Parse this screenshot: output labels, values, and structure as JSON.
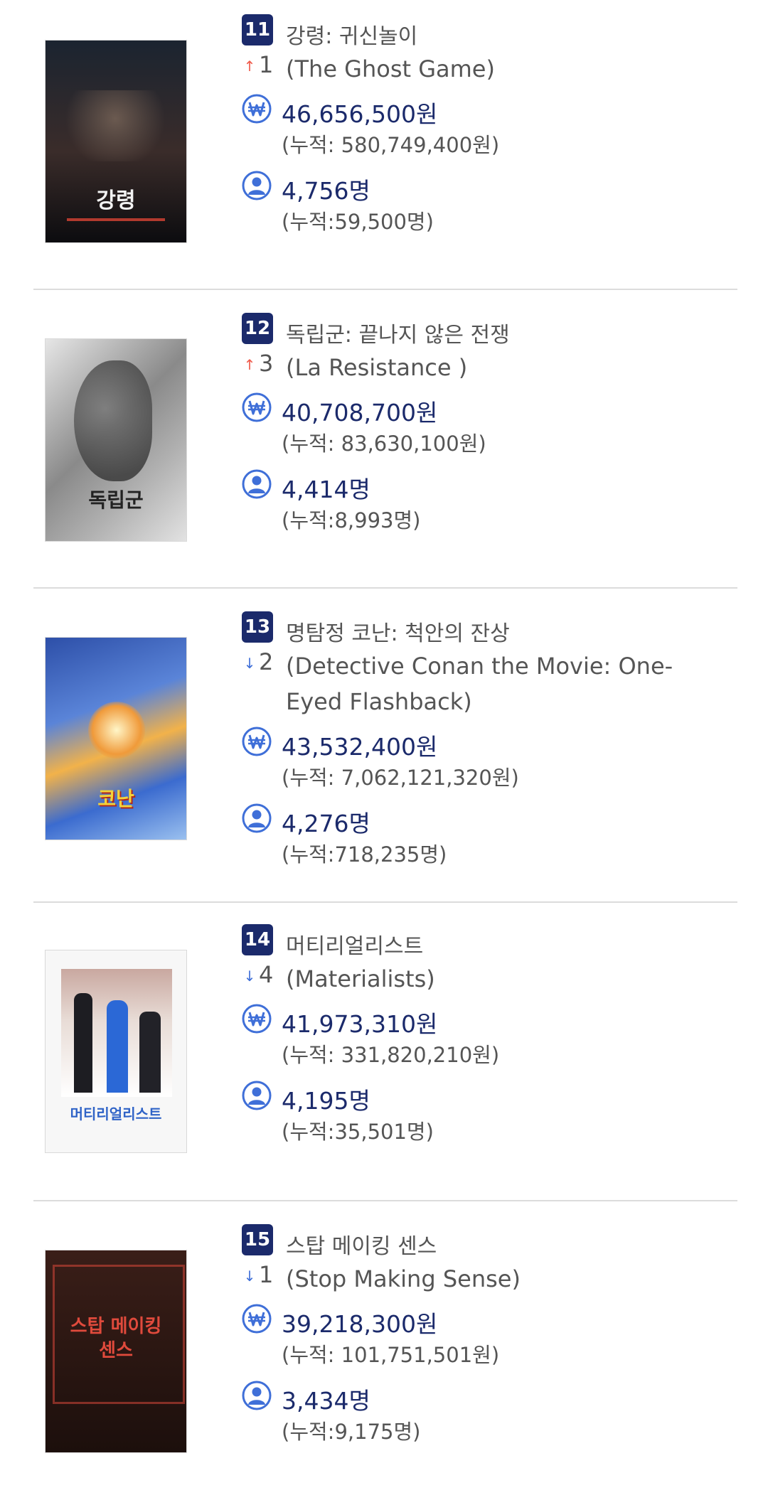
{
  "entries": [
    {
      "rank": "11",
      "change_direction": "up",
      "change": "1",
      "title_ko": "강령: 귀신놀이",
      "title_en": "(The Ghost Game)",
      "sales": "46,656,500원",
      "sales_total": "(누적: 580,749,400원)",
      "audience": "4,756명",
      "audience_total": "(누적:59,500명)",
      "poster_title": "강령",
      "poster_colors": [
        "#1b2430",
        "#2b1214"
      ]
    },
    {
      "rank": "12",
      "change_direction": "up",
      "change": "3",
      "title_ko": "독립군: 끝나지 않은 전쟁",
      "title_en": "(La Resistance )",
      "sales": "40,708,700원",
      "sales_total": "(누적: 83,630,100원)",
      "audience": "4,414명",
      "audience_total": "(누적:8,993명)",
      "poster_title": "독립군",
      "poster_colors": [
        "#d8d8d8",
        "#6a6a6a"
      ]
    },
    {
      "rank": "13",
      "change_direction": "down",
      "change": "2",
      "title_ko": "명탐정 코난: 척안의 잔상",
      "title_en": "(Detective Conan the Movie: One-Eyed Flashback)",
      "sales": "43,532,400원",
      "sales_total": "(누적: 7,062,121,320원)",
      "audience": "4,276명",
      "audience_total": "(누적:718,235명)",
      "poster_title": "코난",
      "poster_colors": [
        "#3a6ed0",
        "#f0a040"
      ]
    },
    {
      "rank": "14",
      "change_direction": "down",
      "change": "4",
      "title_ko": "머티리얼리스트",
      "title_en": "(Materialists)",
      "sales": "41,973,310원",
      "sales_total": "(누적: 331,820,210원)",
      "audience": "4,195명",
      "audience_total": "(누적:35,501명)",
      "poster_title": "머티리얼리스트",
      "poster_colors": [
        "#f4f4f4",
        "#c9a8a0"
      ]
    },
    {
      "rank": "15",
      "change_direction": "down",
      "change": "1",
      "title_ko": "스탑 메이킹 센스",
      "title_en": "(Stop Making Sense)",
      "sales": "39,218,300원",
      "sales_total": "(누적: 101,751,501원)",
      "audience": "3,434명",
      "audience_total": "(누적:9,175명)",
      "poster_title": "스탑 메이킹 센스",
      "poster_colors": [
        "#2a1612",
        "#d9473a"
      ]
    }
  ],
  "icons": {
    "sales": "won-coin-icon",
    "audience": "person-icon",
    "up": "arrow-up-icon",
    "down": "arrow-down-icon"
  },
  "colors": {
    "accent": "#1b2a6b",
    "icon": "#3f6fd8",
    "up": "#ef5a4a",
    "down": "#3f6fd8"
  }
}
